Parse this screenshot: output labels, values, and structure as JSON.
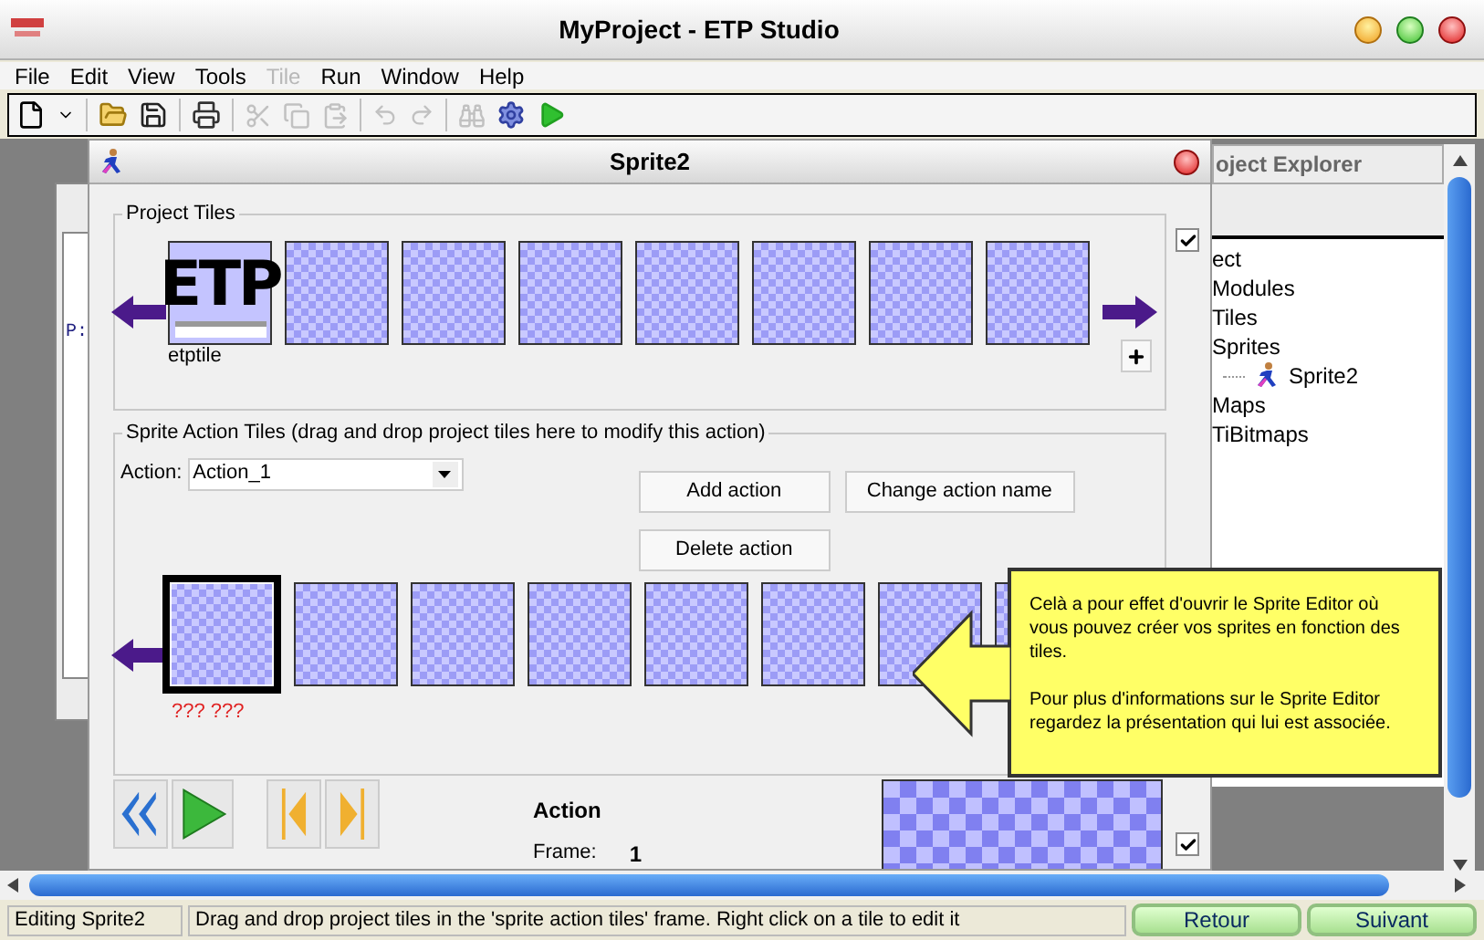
{
  "window": {
    "title": "MyProject - ETP Studio"
  },
  "menu": [
    {
      "label": "File",
      "disabled": false
    },
    {
      "label": "Edit",
      "disabled": false
    },
    {
      "label": "View",
      "disabled": false
    },
    {
      "label": "Tools",
      "disabled": false
    },
    {
      "label": "Tile",
      "disabled": true
    },
    {
      "label": "Run",
      "disabled": false
    },
    {
      "label": "Window",
      "disabled": false
    },
    {
      "label": "Help",
      "disabled": false
    }
  ],
  "toolbar": [
    {
      "kind": "new",
      "disabled": false
    },
    {
      "kind": "dropdown",
      "disabled": false
    },
    {
      "kind": "separator"
    },
    {
      "kind": "open",
      "disabled": false
    },
    {
      "kind": "save",
      "disabled": false
    },
    {
      "kind": "separator"
    },
    {
      "kind": "print",
      "disabled": false
    },
    {
      "kind": "separator"
    },
    {
      "kind": "cut",
      "disabled": true
    },
    {
      "kind": "copy",
      "disabled": true
    },
    {
      "kind": "paste",
      "disabled": true
    },
    {
      "kind": "separator"
    },
    {
      "kind": "undo",
      "disabled": true
    },
    {
      "kind": "redo",
      "disabled": true
    },
    {
      "kind": "separator"
    },
    {
      "kind": "find",
      "disabled": true
    },
    {
      "kind": "build",
      "disabled": false
    },
    {
      "kind": "run",
      "disabled": false
    }
  ],
  "back_window": {
    "text": "P:"
  },
  "sprite_window": {
    "title": "Sprite2",
    "project_tiles": {
      "legend": "Project Tiles",
      "checked": true,
      "tiles": [
        {
          "kind": "etp",
          "text": "ETP",
          "label": "etptile"
        },
        {
          "kind": "empty"
        },
        {
          "kind": "empty"
        },
        {
          "kind": "empty"
        },
        {
          "kind": "empty"
        },
        {
          "kind": "empty"
        },
        {
          "kind": "empty"
        },
        {
          "kind": "empty"
        }
      ]
    },
    "action_tiles": {
      "legend": "Sprite Action Tiles (drag and drop project tiles here to modify this action)",
      "action_label": "Action:",
      "action_value": "Action_1",
      "buttons": [
        {
          "label": "Add action"
        },
        {
          "label": "Change action name"
        },
        {
          "label": "Delete action"
        }
      ],
      "tiles": [
        {
          "selected": true
        },
        {
          "selected": false
        },
        {
          "selected": false
        },
        {
          "selected": false
        },
        {
          "selected": false
        },
        {
          "selected": false
        },
        {
          "selected": false
        },
        {
          "selected": false
        }
      ],
      "tile_caption": "??? ???"
    },
    "preview": {
      "heading": "Action",
      "frame_label": "Frame:",
      "frame_value": "1",
      "checked": true
    }
  },
  "explorer": {
    "title": "oject Explorer",
    "items": [
      {
        "label": "ect",
        "children": [
          {
            "label": "Modules"
          },
          {
            "label": "Tiles"
          },
          {
            "label": "Sprites",
            "children": [
              {
                "label": "Sprite2",
                "icon": true
              }
            ]
          },
          {
            "label": "Maps"
          },
          {
            "label": "TiBitmaps"
          }
        ]
      }
    ]
  },
  "callout": {
    "paragraphs": [
      "Celà a pour effet d'ouvrir le Sprite Editor où vous pouvez créer vos sprites en fonction des tiles.",
      "Pour plus d'informations sur le Sprite Editor regardez la présentation qui lui est associée."
    ]
  },
  "status_bar": {
    "state": "Editing Sprite2",
    "message": "Drag and drop project tiles in the 'sprite action tiles' frame. Right click on a tile to edit it",
    "buttons": [
      {
        "label": "Retour"
      },
      {
        "label": "Suivant"
      }
    ]
  }
}
